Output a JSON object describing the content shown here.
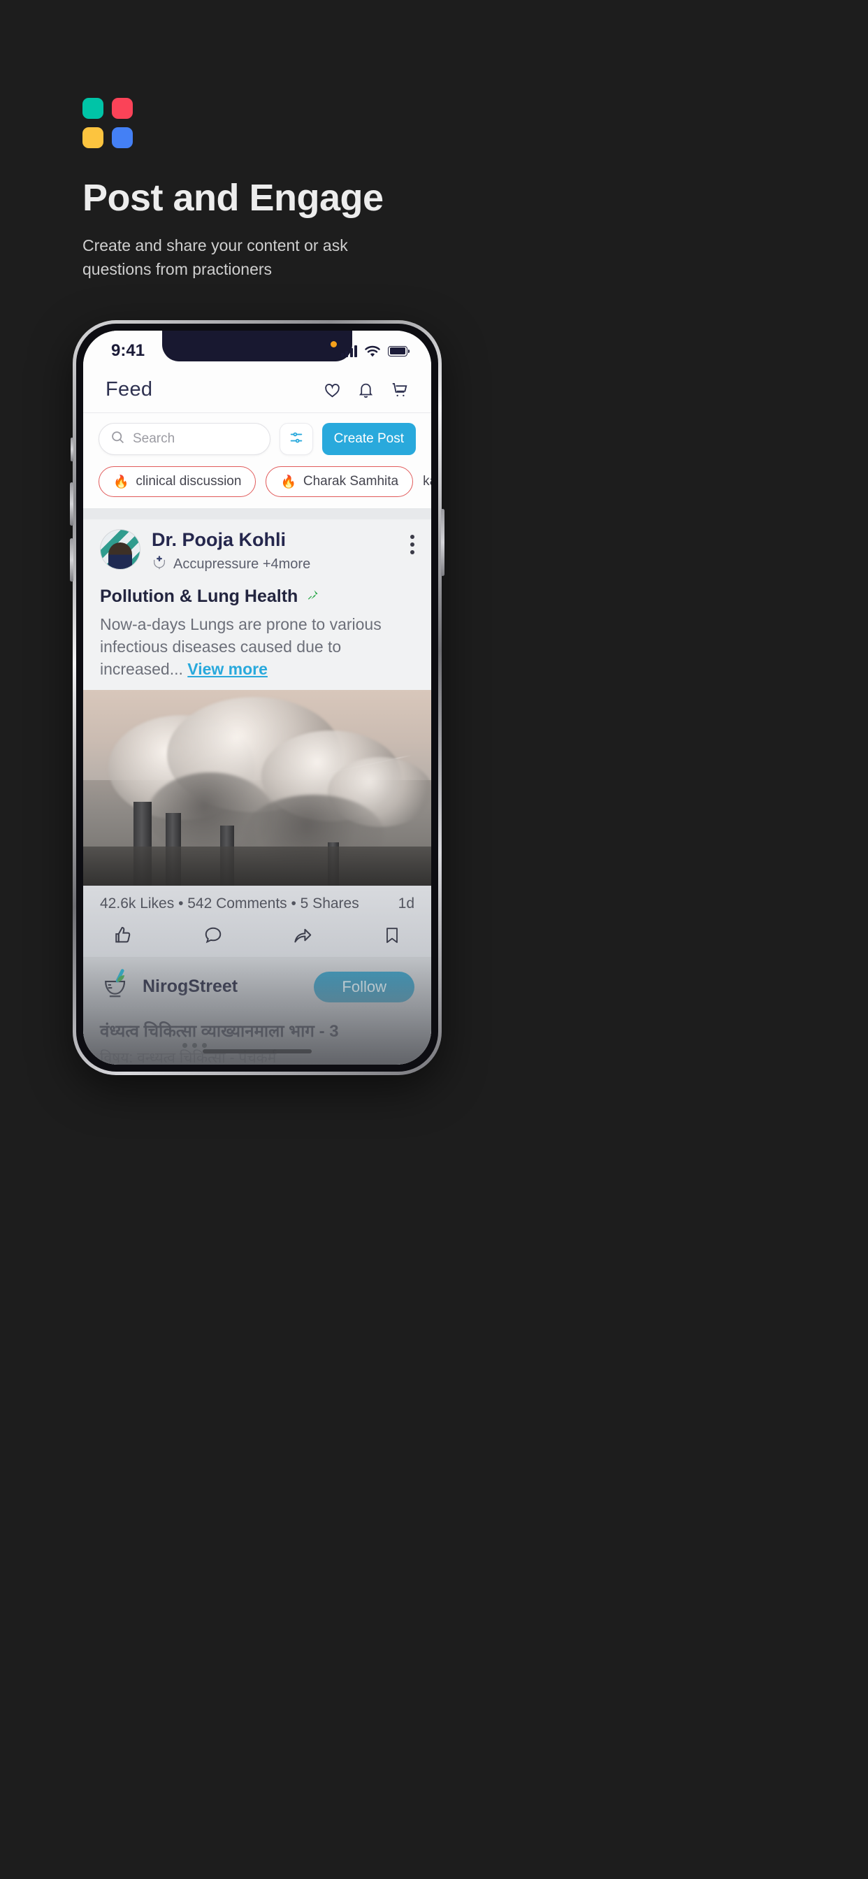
{
  "hero": {
    "title": "Post and Engage",
    "subtitle": "Create  and share your content or ask questions from practioners",
    "logo_colors": [
      "#00c4a7",
      "#fb4358",
      "#fcc43f",
      "#4480f5"
    ]
  },
  "phone": {
    "status": {
      "time": "9:41",
      "orange_dot_color": "#f5a11b",
      "icons": [
        "signal-bars",
        "wifi",
        "battery"
      ]
    },
    "header": {
      "title": "Feed",
      "icons": [
        "heart-icon",
        "bell-icon",
        "cart-icon"
      ]
    },
    "search": {
      "placeholder": "Search",
      "filter_icon": "filter-icon",
      "create_post_label": "Create Post",
      "accent_color": "#29a9dc"
    },
    "chips": [
      {
        "label": "clinical discussion",
        "icon": "flame-icon",
        "outlined": true
      },
      {
        "label": "Charak Samhita",
        "icon": "flame-icon",
        "outlined": true
      },
      {
        "label": "kayach",
        "icon": "",
        "outlined": false
      }
    ],
    "post": {
      "author": "Dr. Pooja Kohli",
      "specialty": "Accupressure +4more",
      "specialty_icon": "ayurveda-hands-icon",
      "menu_icon": "kebab-menu-icon",
      "title": "Pollution & Lung Health",
      "pin_icon": "pin-icon",
      "pin_color": "#2aa84a",
      "body": "Now-a-days Lungs are prone to various infectious diseases caused due to increased...",
      "view_more": "View more",
      "image_alt": "factory-smokestacks-photo",
      "stats": "42.6k Likes  •  542 Comments  •  5 Shares",
      "timestamp": "1d",
      "actions": [
        "like-icon",
        "comment-icon",
        "share-icon",
        "bookmark-icon"
      ]
    },
    "second_post": {
      "name": "NirogStreet",
      "logo_icon": "mortar-pestle-icon",
      "follow_label": "Follow",
      "title": "वंध्यत्व चिकित्सा व्याख्यानमाला भाग - 3",
      "subtitle": "विषय: वन्ध्यत्व चिकित्सा - पंचकर्म"
    }
  }
}
